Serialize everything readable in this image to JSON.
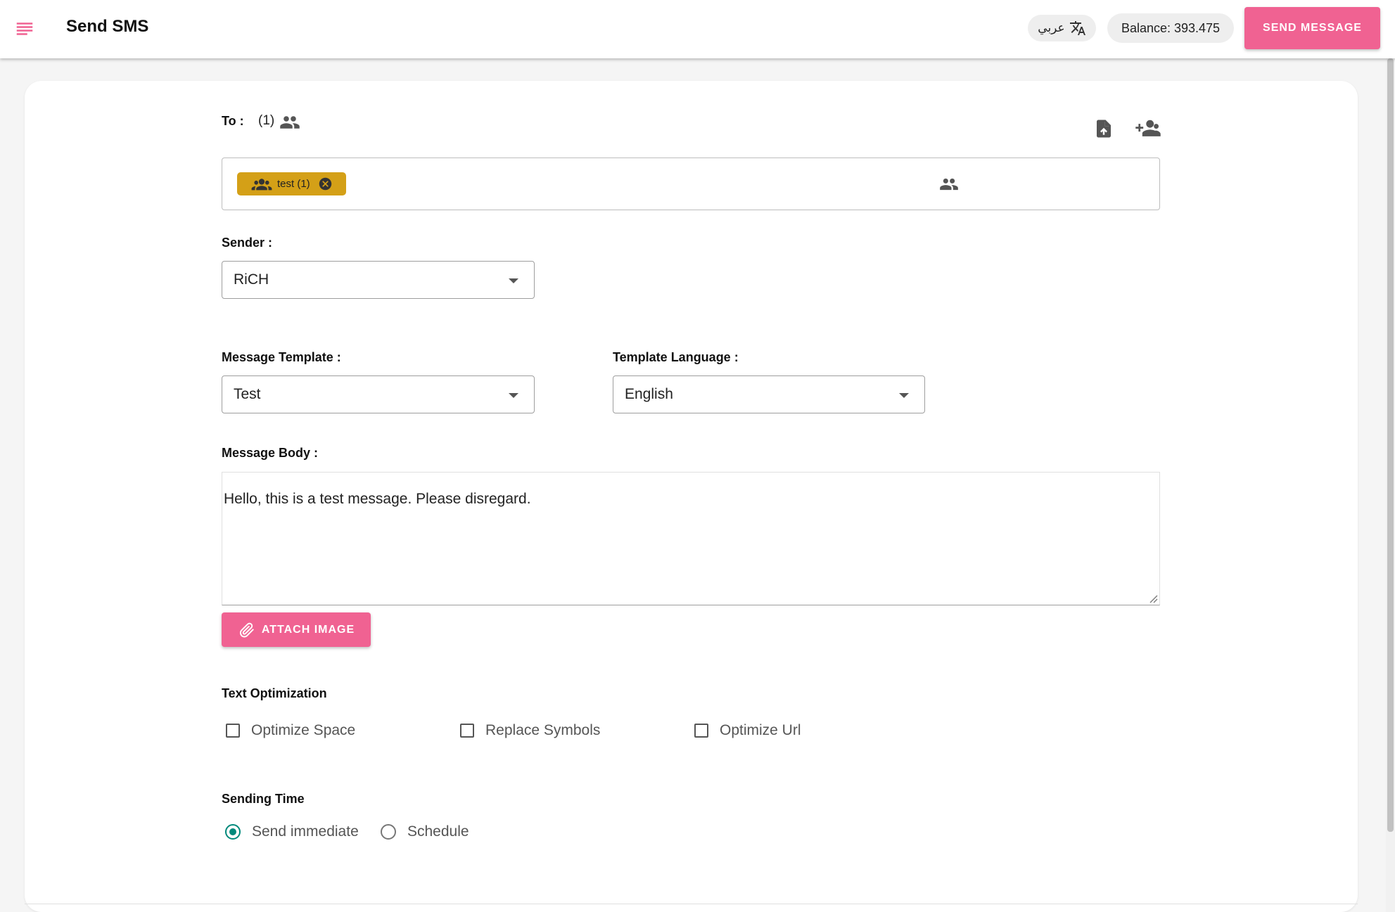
{
  "header": {
    "title": "Send SMS",
    "language_label": "عربي",
    "balance": "Balance: 393.475",
    "send_button": "SEND MESSAGE"
  },
  "recipients": {
    "label": "To :",
    "count": "(1)",
    "chips": [
      {
        "label": "test (1)",
        "color": "#d4a017"
      }
    ]
  },
  "sender": {
    "label": "Sender :",
    "value": "RiCH"
  },
  "template": {
    "label": "Message Template :",
    "value": "Test"
  },
  "template_language": {
    "label": "Template Language :",
    "value": "English"
  },
  "message": {
    "label": "Message Body :",
    "body": "Hello, this is a test message. Please disregard.",
    "attach_button": "ATTACH IMAGE"
  },
  "text_optimization": {
    "label": "Text Optimization",
    "options": [
      {
        "label": "Optimize Space",
        "checked": false
      },
      {
        "label": "Replace Symbols",
        "checked": false
      },
      {
        "label": "Optimize Url",
        "checked": false
      }
    ]
  },
  "sending_time": {
    "label": "Sending Time",
    "options": [
      {
        "label": "Send immediate",
        "selected": true
      },
      {
        "label": "Schedule",
        "selected": false
      }
    ]
  },
  "colors": {
    "accent": "#f06292",
    "chip": "#d4a017",
    "radio_selected": "#00897b"
  },
  "icons": {
    "menu": "menu-icon",
    "translate": "translate-icon",
    "group": "group-icon",
    "upload_file": "upload-file-icon",
    "add_contact": "person-add-icon",
    "attach": "paperclip-icon",
    "remove": "close-circle-icon"
  }
}
